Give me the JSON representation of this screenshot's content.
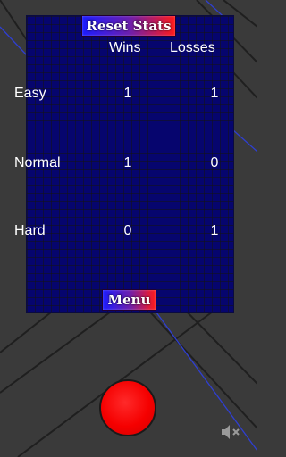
{
  "buttons": {
    "reset_stats": "Reset Stats",
    "menu": "Menu"
  },
  "stats": {
    "headers": {
      "wins": "Wins",
      "losses": "Losses"
    },
    "rows": [
      {
        "difficulty": "Easy",
        "wins": "1",
        "losses": "1"
      },
      {
        "difficulty": "Normal",
        "wins": "1",
        "losses": "0"
      },
      {
        "difficulty": "Hard",
        "wins": "0",
        "losses": "1"
      }
    ]
  },
  "icons": {
    "sound": "mute-speaker-icon"
  },
  "colors": {
    "panel": "#06056e",
    "button_gradient_start": "#1c1cff",
    "button_gradient_end": "#ff1a1a",
    "main_button": "#f50000",
    "background": "#3a3a3a"
  }
}
